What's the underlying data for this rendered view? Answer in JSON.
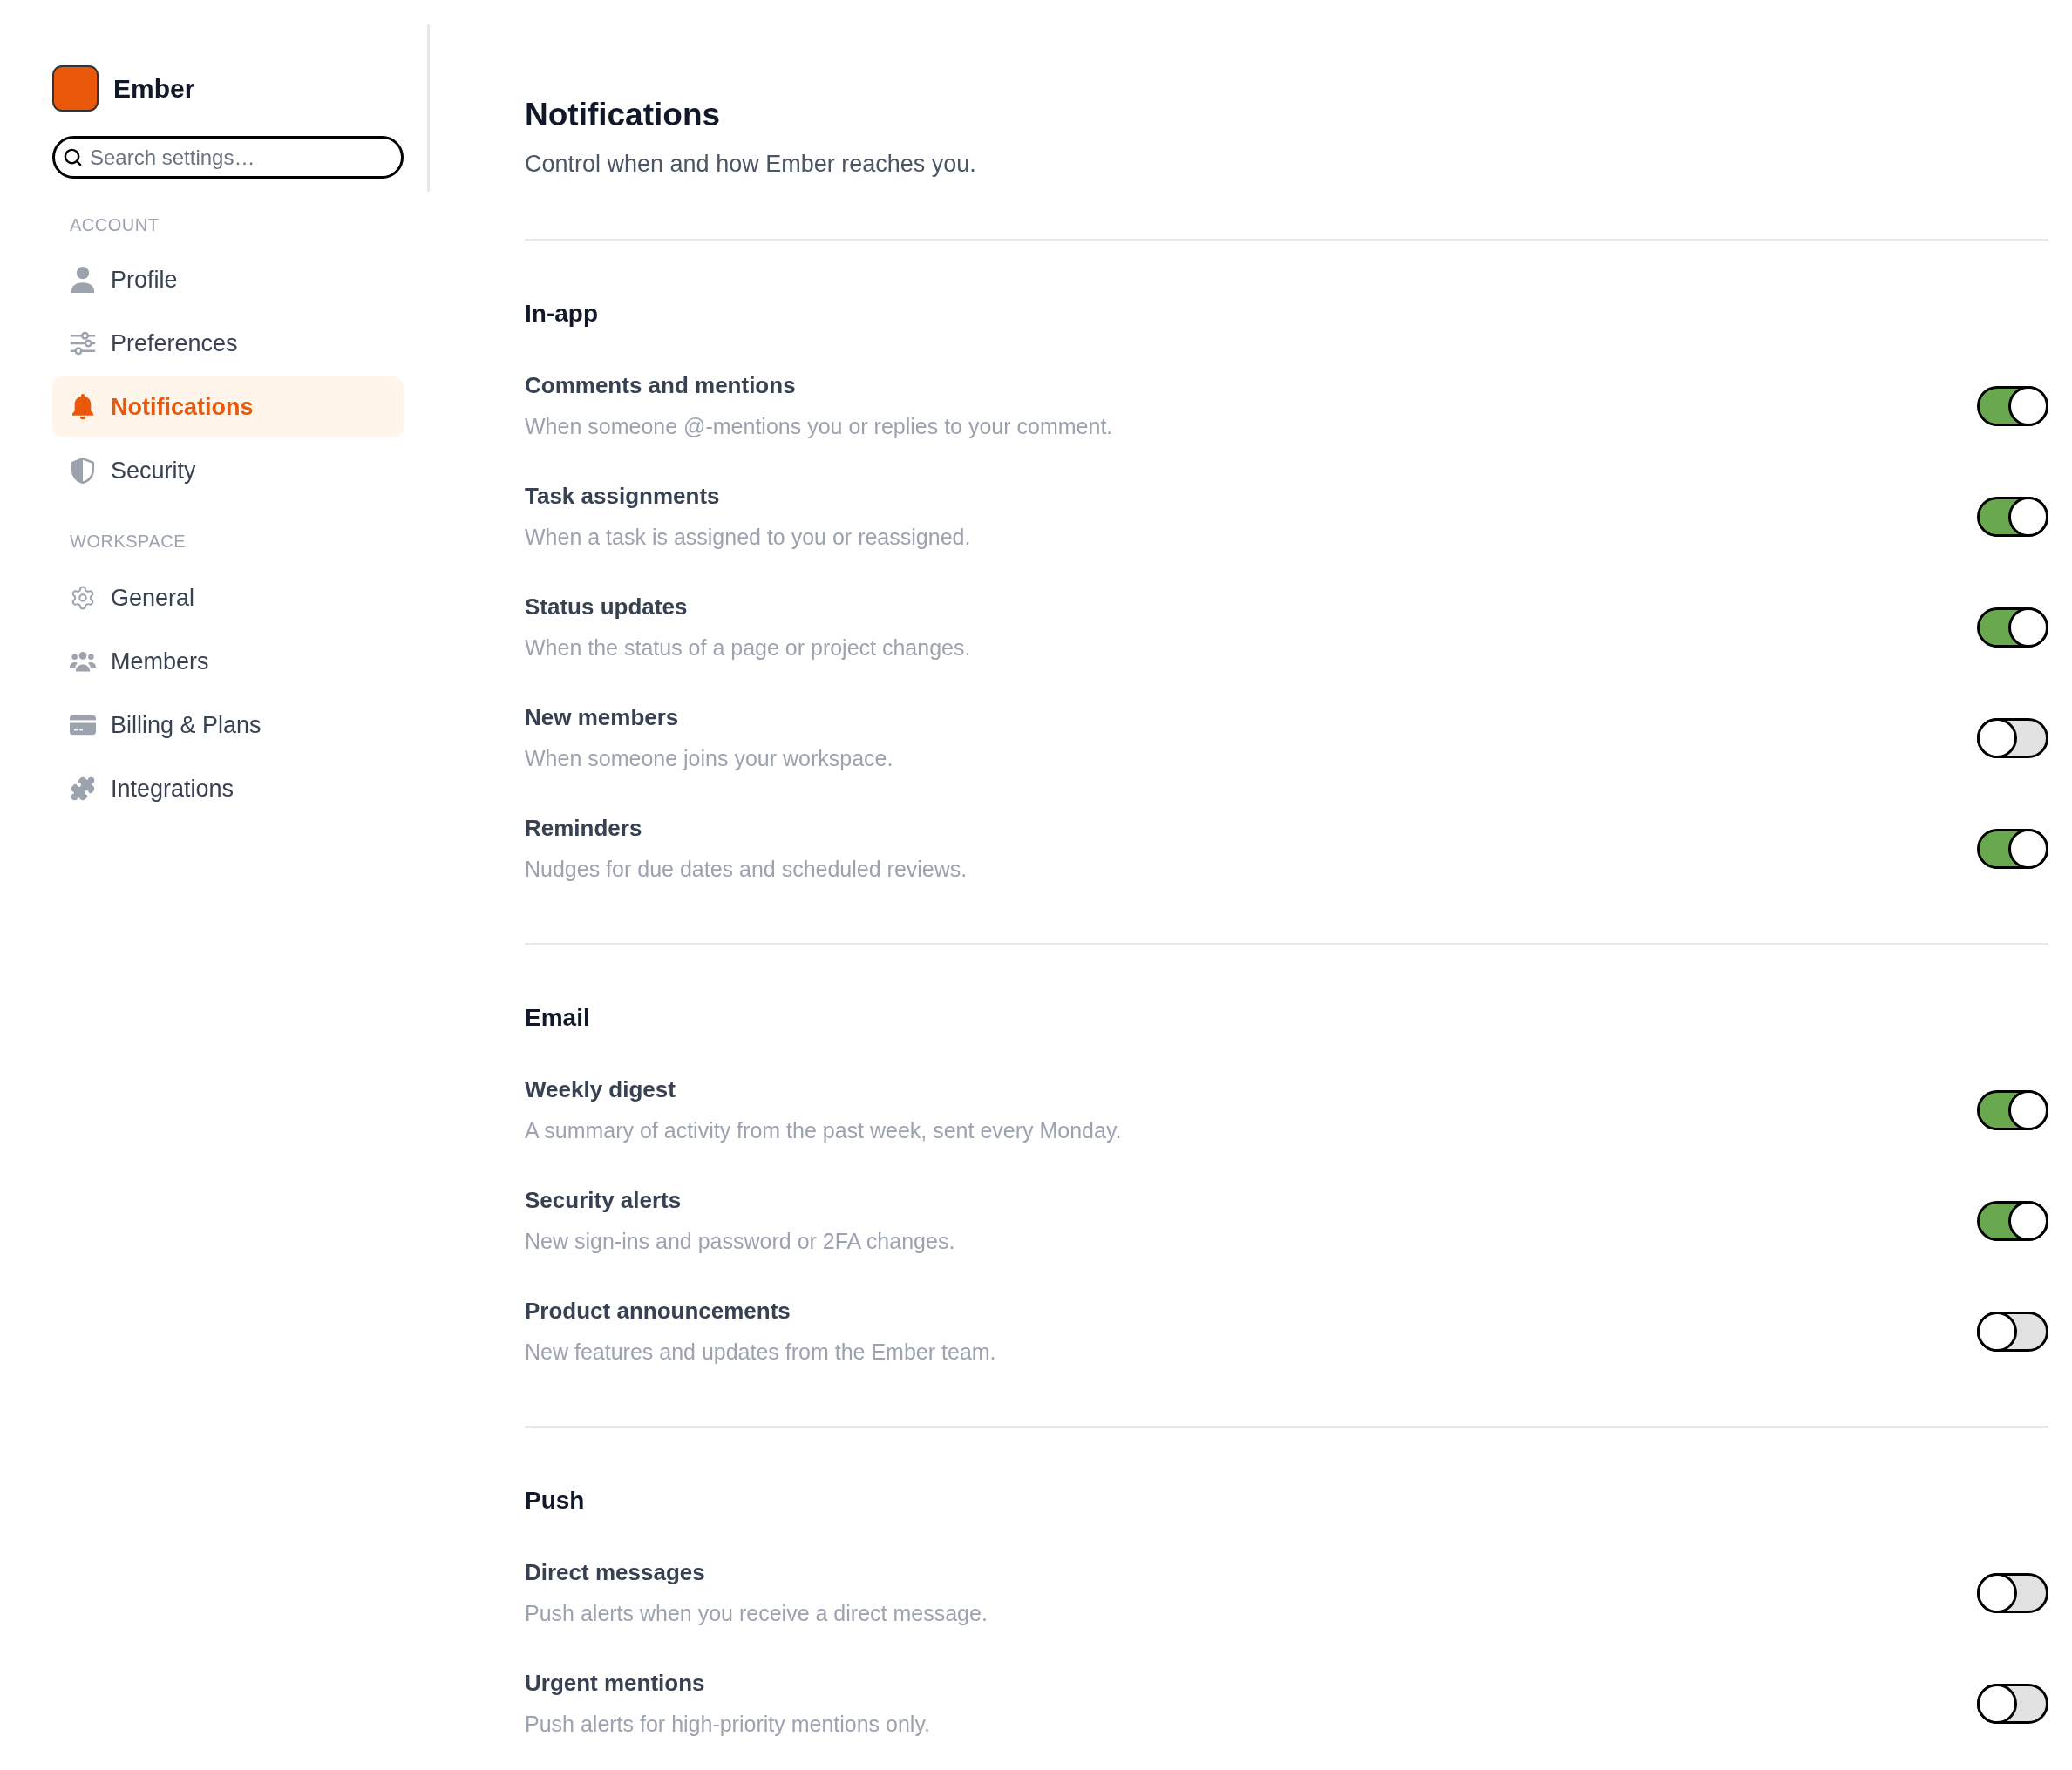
{
  "app": {
    "name": "Ember"
  },
  "search": {
    "placeholder": "Search settings…"
  },
  "nav": [
    {
      "label": "ACCOUNT",
      "items": [
        {
          "label": "Profile",
          "selected": false
        },
        {
          "label": "Preferences",
          "selected": false
        },
        {
          "label": "Notifications",
          "selected": true
        },
        {
          "label": "Security",
          "selected": false
        }
      ]
    },
    {
      "label": "WORKSPACE",
      "items": [
        {
          "label": "General",
          "selected": false
        },
        {
          "label": "Members",
          "selected": false
        },
        {
          "label": "Billing & Plans",
          "selected": false
        },
        {
          "label": "Integrations",
          "selected": false
        }
      ]
    }
  ],
  "page": {
    "title": "Notifications",
    "subtitle": "Control when and how Ember reaches you."
  },
  "sections": [
    {
      "title": "In-app",
      "items": [
        {
          "title": "Comments and mentions",
          "description": "When someone @-mentions you or replies to your comment.",
          "on": true
        },
        {
          "title": "Task assignments",
          "description": "When a task is assigned to you or reassigned.",
          "on": true
        },
        {
          "title": "Status updates",
          "description": "When the status of a page or project changes.",
          "on": true
        },
        {
          "title": "New members",
          "description": "When someone joins your workspace.",
          "on": false
        },
        {
          "title": "Reminders",
          "description": "Nudges for due dates and scheduled reviews.",
          "on": true
        }
      ]
    },
    {
      "title": "Email",
      "items": [
        {
          "title": "Weekly digest",
          "description": "A summary of activity from the past week, sent every Monday.",
          "on": true
        },
        {
          "title": "Security alerts",
          "description": "New sign-ins and password or 2FA changes.",
          "on": true
        },
        {
          "title": "Product announcements",
          "description": "New features and updates from the Ember team.",
          "on": false
        }
      ]
    },
    {
      "title": "Push",
      "items": [
        {
          "title": "Direct messages",
          "description": "Push alerts when you receive a direct message.",
          "on": false
        },
        {
          "title": "Urgent mentions",
          "description": "Push alerts for high-priority mentions only.",
          "on": false
        }
      ]
    }
  ]
}
